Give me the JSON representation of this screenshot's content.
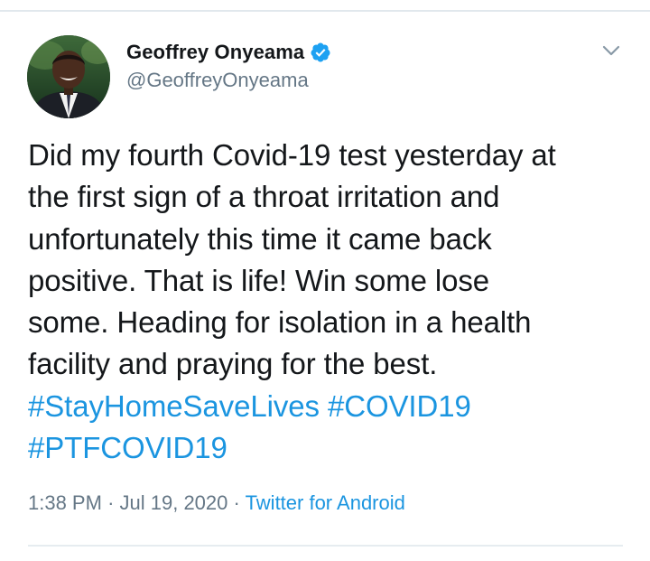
{
  "tweet": {
    "author": {
      "display_name": "Geoffrey Onyeama",
      "handle": "@GeoffreyOnyeama",
      "verified": true
    },
    "text_lines": [
      "Did my fourth Covid-19 test yesterday at",
      "the first sign of a throat irritation and",
      "unfortunately this time it came back",
      "positive. That is life! Win some lose",
      "some. Heading for isolation in a health",
      "facility and praying for the best."
    ],
    "hashtags": [
      "#StayHomeSaveLives",
      "#COVID19",
      "#PTFCOVID19"
    ],
    "time": "1:38 PM",
    "date": "Jul 19, 2020",
    "separator": "·",
    "source": "Twitter for Android"
  },
  "icons": {
    "verified": "verified-badge-icon",
    "caret": "chevron-down-icon"
  },
  "colors": {
    "link": "#1b95e0",
    "secondary_text": "#657786",
    "primary_text": "#14171a",
    "verified_badge": "#1da1f2",
    "divider": "#e6ecf0"
  }
}
